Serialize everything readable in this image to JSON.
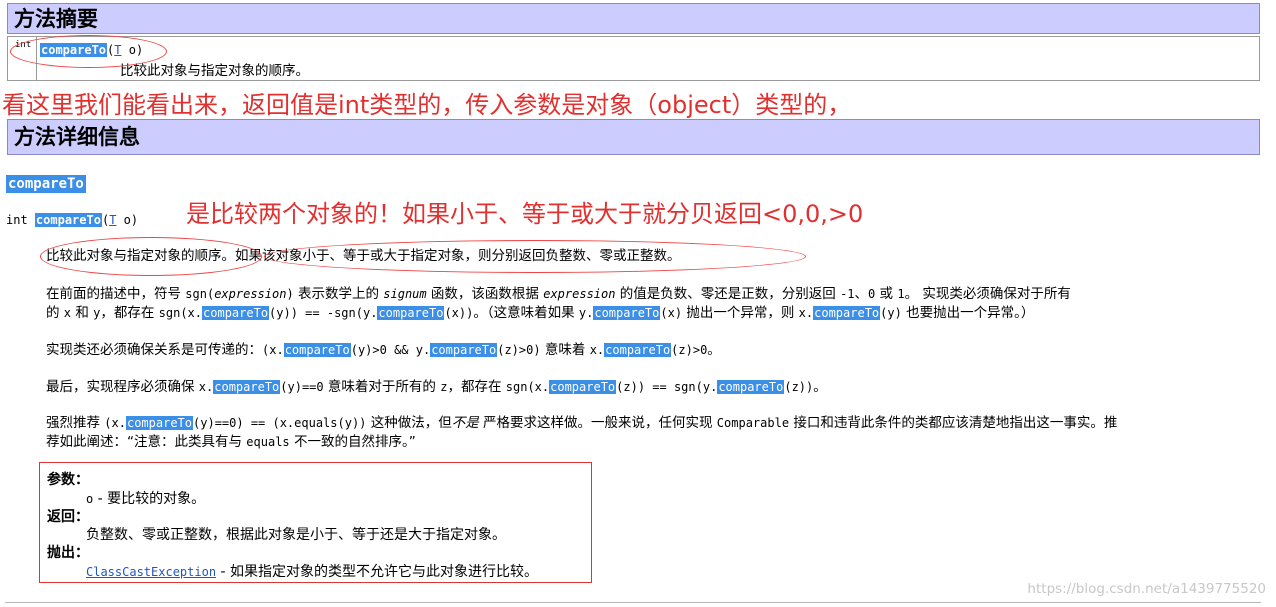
{
  "summary": {
    "header": "方法摘要",
    "return_type": "int",
    "method_name": "compareTo",
    "params_open": "(",
    "param_type": "T",
    "params_rest": " o)",
    "description": "比较此对象与指定对象的顺序。"
  },
  "annotation_1": "看这里我们能看出来，返回值是int类型的，传入参数是对象（object）类型的，",
  "detail": {
    "header": "方法详细信息",
    "anchor": "compareTo",
    "sig_type": "int",
    "sig_name": "compareTo",
    "sig_open": "(",
    "sig_param_type": "T",
    "sig_rest": " o)"
  },
  "annotation_2": "是比较两个对象的！如果小于、等于或大于就分贝返回<0,0,>0",
  "paragraphs": {
    "p1": "比较此对象与指定对象的顺序。如果该对象小于、等于或大于指定对象，则分别返回负整数、零或正整数。",
    "p2_a": "在前面的描述中，符号 ",
    "p2_b": "sgn(",
    "p2_c": "expression",
    "p2_d": ")",
    "p2_e": " 表示数学上的 ",
    "p2_f": "signum",
    "p2_g": " 函数，该函数根据 ",
    "p2_h": "expression",
    "p2_i": " 的值是负数、零还是正数，分别返回 ",
    "p2_j": "-1",
    "p2_k": "、",
    "p2_l": "0",
    "p2_m": " 或 ",
    "p2_n": "1",
    "p2_o": "。 实现类必须确保对于所有",
    "p2_line2_a": "的 ",
    "p2_line2_b": "x",
    "p2_line2_c": " 和 ",
    "p2_line2_d": "y",
    "p2_line2_e": "，都存在 ",
    "p2_line2_f": "sgn(x.",
    "p2_line2_g": "compareTo",
    "p2_line2_h": "(y)) == -sgn(y.",
    "p2_line2_i": "compareTo",
    "p2_line2_j": "(x))",
    "p2_line2_k": "。（这意味着如果 ",
    "p2_line2_l": "y.",
    "p2_line2_m": "compareTo",
    "p2_line2_n": "(x)",
    "p2_line2_o": " 抛出一个异常，则 ",
    "p2_line2_p": "x.",
    "p2_line2_q": "compareTo",
    "p2_line2_r": "(y)",
    "p2_line2_s": " 也要抛出一个异常。）",
    "p3_a": "实现类还必须确保关系是可传递的：",
    "p3_b": "(x.",
    "p3_c": "compareTo",
    "p3_d": "(y)>0 && y.",
    "p3_e": "compareTo",
    "p3_f": "(z)>0)",
    "p3_g": " 意味着 ",
    "p3_h": "x.",
    "p3_i": "compareTo",
    "p3_j": "(z)>0",
    "p3_k": "。",
    "p4_a": "最后，实现程序必须确保 ",
    "p4_b": "x.",
    "p4_c": "compareTo",
    "p4_d": "(y)==0",
    "p4_e": " 意味着对于所有的 ",
    "p4_f": "z",
    "p4_g": "，都存在 ",
    "p4_h": "sgn(x.",
    "p4_i": "compareTo",
    "p4_j": "(z)) == sgn(y.",
    "p4_k": "compareTo",
    "p4_l": "(z))",
    "p4_m": "。",
    "p5_a": "强烈推荐 ",
    "p5_b": "(x.",
    "p5_c": "compareTo",
    "p5_d": "(y)==0) == (x.equals(y))",
    "p5_e": " 这种做法，但",
    "p5_f": "不是",
    "p5_g": " 严格要求这样做。一般来说，任何实现 ",
    "p5_h": "Comparable",
    "p5_i": " 接口和违背此条件的类都应该清楚地指出这一事实。推",
    "p5_line2_a": "荐如此阐述：“注意：此类具有与 ",
    "p5_line2_b": "equals",
    "p5_line2_c": " 不一致的自然排序。”"
  },
  "params": {
    "params_label": "参数：",
    "param_o_name": "o",
    "param_o_desc": " - 要比较的对象。",
    "returns_label": "返回：",
    "returns_desc": "负整数、零或正整数，根据此对象是小于、等于还是大于指定对象。",
    "throws_label": "抛出：",
    "throws_link": "ClassCastException",
    "throws_desc": " - 如果指定对象的类型不允许它与此对象进行比较。"
  },
  "watermark": "https://blog.csdn.net/a1439775520",
  "colors": {
    "header_bg": "#ccccff",
    "highlight": "#3b8fe6",
    "annotation_red": "#e0302f",
    "link": "#2255bb"
  }
}
